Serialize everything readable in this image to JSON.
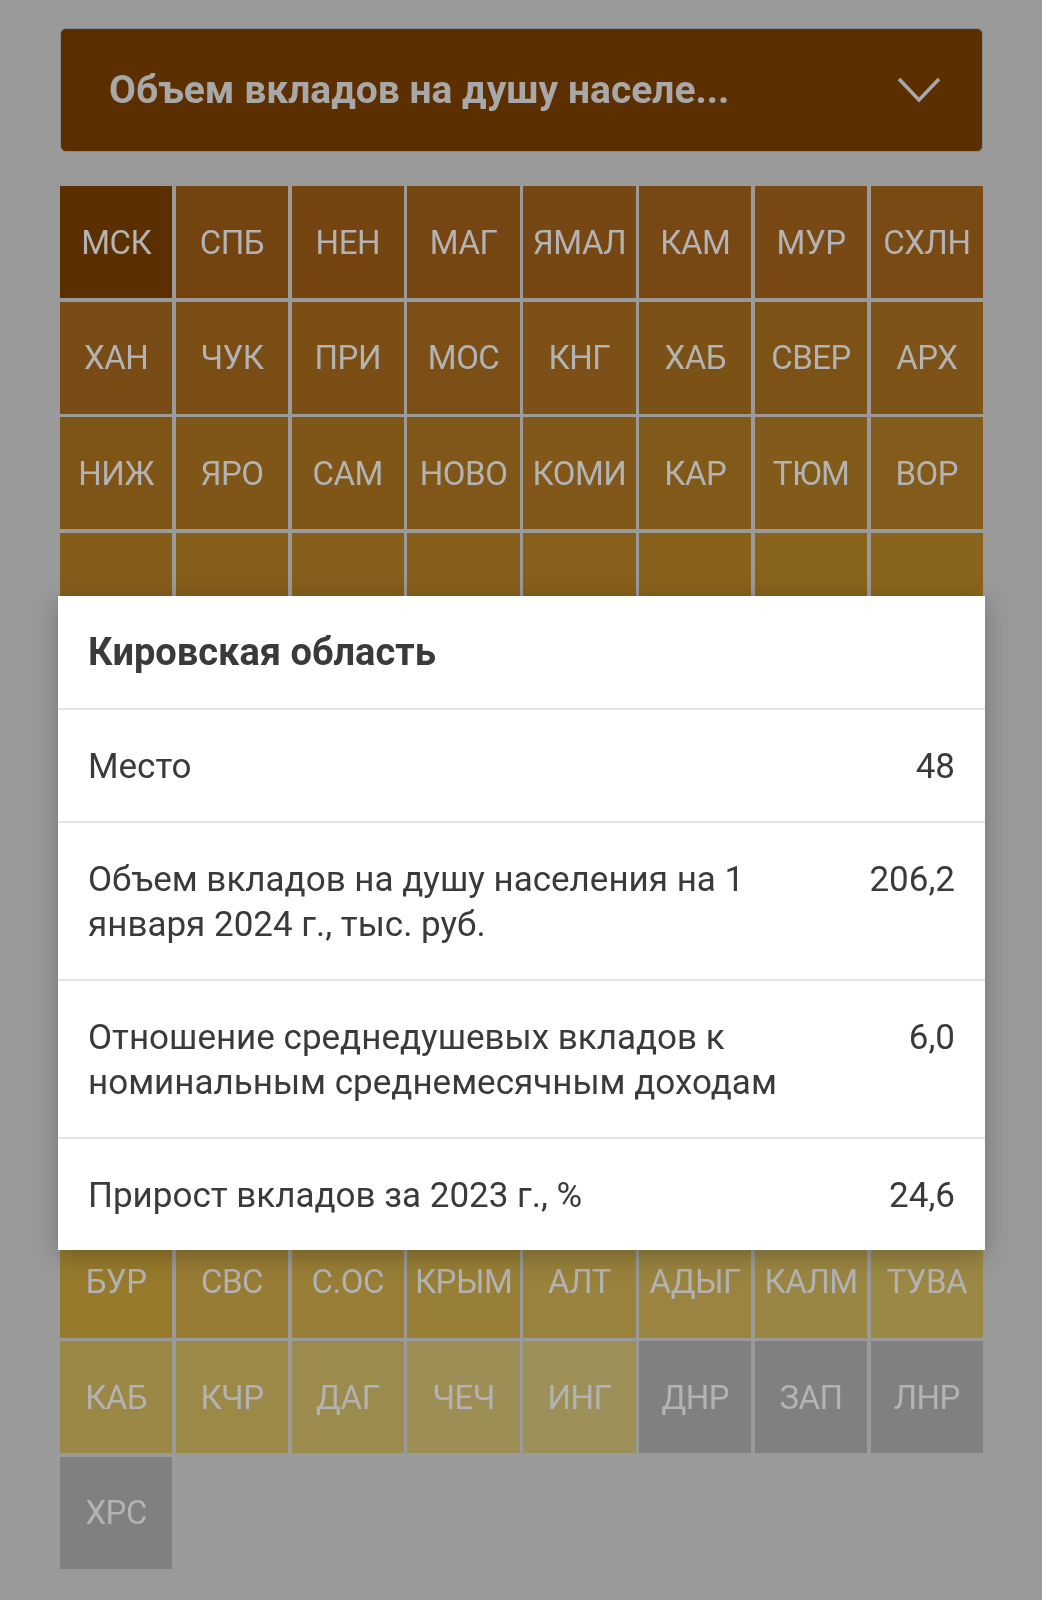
{
  "dropdown": {
    "value": "Объем вкладов на душу населе..."
  },
  "tiles_top": [
    {
      "label": "МСК",
      "color": "#5c2f00"
    },
    {
      "label": "СПБ",
      "color": "#734310"
    },
    {
      "label": "НЕН",
      "color": "#744511"
    },
    {
      "label": "МАГ",
      "color": "#754612"
    },
    {
      "label": "ЯМАЛ",
      "color": "#764713"
    },
    {
      "label": "КАМ",
      "color": "#774813"
    },
    {
      "label": "МУР",
      "color": "#784914"
    },
    {
      "label": "СХЛН",
      "color": "#794a14"
    },
    {
      "label": "ХАН",
      "color": "#7a4c15"
    },
    {
      "label": "ЧУК",
      "color": "#7a4d15"
    },
    {
      "label": "ПРИ",
      "color": "#7b4e15"
    },
    {
      "label": "МОС",
      "color": "#7b4f16"
    },
    {
      "label": "КНГ",
      "color": "#7c5016"
    },
    {
      "label": "ХАБ",
      "color": "#7c5116"
    },
    {
      "label": "СВЕР",
      "color": "#7d5217"
    },
    {
      "label": "АРХ",
      "color": "#7d5317"
    },
    {
      "label": "НИЖ",
      "color": "#7e5417"
    },
    {
      "label": "ЯРО",
      "color": "#7f5518"
    },
    {
      "label": "САМ",
      "color": "#7f5618"
    },
    {
      "label": "НОВО",
      "color": "#805718"
    },
    {
      "label": "КОМИ",
      "color": "#815819"
    },
    {
      "label": "КАР",
      "color": "#815919"
    },
    {
      "label": "ТЮМ",
      "color": "#825a19"
    },
    {
      "label": "ВОР",
      "color": "#835b1a"
    },
    {
      "color": "#845d1a"
    },
    {
      "color": "#855e1a"
    },
    {
      "color": "#855f1b"
    },
    {
      "color": "#86601b"
    },
    {
      "color": "#87611b"
    },
    {
      "color": "#88621b"
    },
    {
      "color": "#88631c"
    },
    {
      "color": "#89641c"
    }
  ],
  "tiles_bottom": [
    {
      "label": "БУР",
      "color": "#977a2c"
    },
    {
      "label": "СВС",
      "color": "#977c34"
    },
    {
      "label": "С.ОС",
      "color": "#987e36"
    },
    {
      "label": "КРЫМ",
      "color": "#987f36"
    },
    {
      "label": "АЛТ",
      "color": "#99823c"
    },
    {
      "label": "АДЫГ",
      "color": "#9a8440"
    },
    {
      "label": "КАЛМ",
      "color": "#9a8643"
    },
    {
      "label": "ТУВА",
      "color": "#9b8845"
    },
    {
      "label": "КАБ",
      "color": "#9b8846"
    },
    {
      "label": "КЧР",
      "color": "#9b8948"
    },
    {
      "label": "ДАГ",
      "color": "#9b8b4d"
    },
    {
      "label": "ЧЕЧ",
      "color": "#9c8e55"
    },
    {
      "label": "ИНГ",
      "color": "#9c8f58"
    },
    {
      "label": "ДНР",
      "color": "#808080"
    },
    {
      "label": "ЗАП",
      "color": "#808080"
    },
    {
      "label": "ЛНР",
      "color": "#808080"
    },
    {
      "label": "ХРС",
      "color": "#808080"
    }
  ],
  "popup": {
    "title": "Кировская область",
    "rows": [
      {
        "label": "Место",
        "value": "48"
      },
      {
        "label": "Объем вкладов на душу населения на 1 января 2024 г., тыс. руб.",
        "value": "206,2"
      },
      {
        "label": "Отношение среднедушевых вкладов к номинальным среднемесячным доходам",
        "value": "6,0"
      },
      {
        "label": "Прирост вкладов за 2023 г., %",
        "value": "24,6"
      }
    ]
  }
}
